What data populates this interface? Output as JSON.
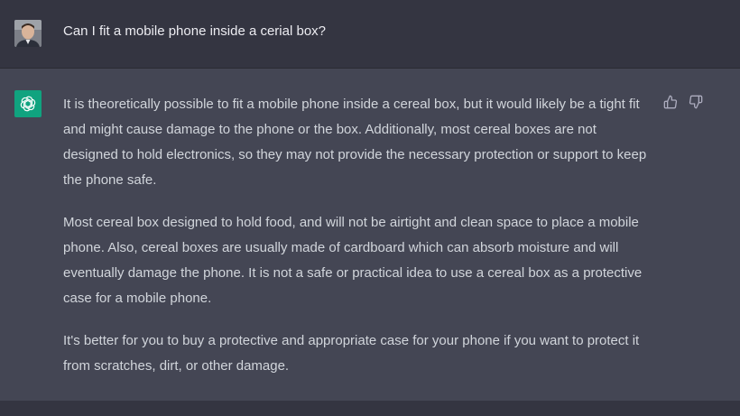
{
  "user_message": {
    "avatar_icon": "user-avatar-photo",
    "text": "Can I fit a mobile phone inside a cerial box?"
  },
  "assistant_message": {
    "avatar_icon": "openai-logo-icon",
    "paragraphs": [
      "It is theoretically possible to fit a mobile phone inside a cereal box, but it would likely be a tight fit and might cause damage to the phone or the box. Additionally, most cereal boxes are not designed to hold electronics, so they may not provide the necessary protection or support to keep the phone safe.",
      "Most cereal box designed to hold food, and will not be airtight and clean space to place a mobile phone. Also, cereal boxes are usually made of cardboard which can absorb moisture and will eventually damage the phone. It is not a safe or practical idea to use a cereal box as a protective case for a mobile phone.",
      "It's better for you to buy a protective and appropriate case for your phone if you want to protect it from scratches, dirt, or other damage."
    ],
    "feedback_icons": [
      "thumbs-up-icon",
      "thumbs-down-icon"
    ]
  },
  "colors": {
    "page_bg": "#343541",
    "assistant_bg": "#444654",
    "accent": "#10a37f",
    "text_user": "#ececf1",
    "text_assistant": "#d1d5db"
  }
}
